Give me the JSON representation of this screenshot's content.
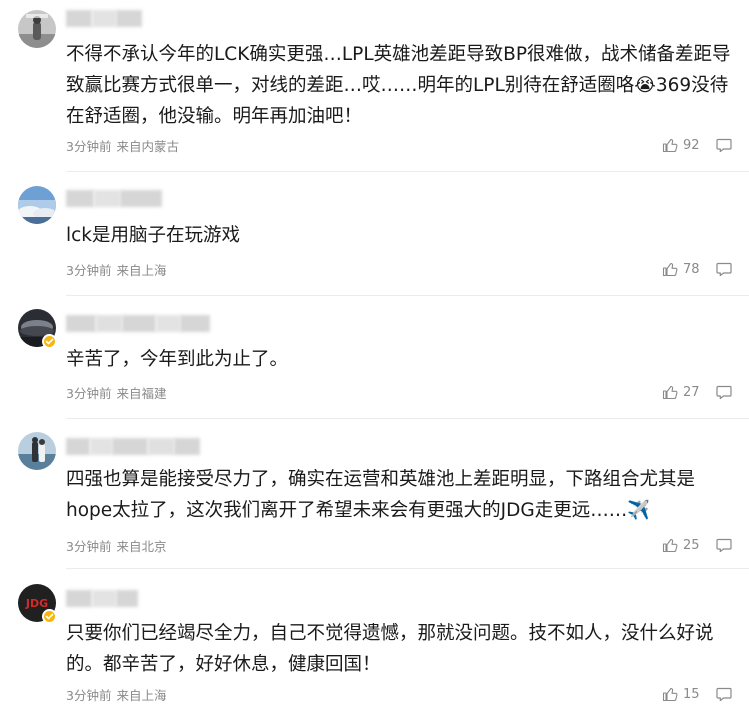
{
  "comments": [
    {
      "text": "不得不承认今年的LCK确实更强…LPL英雄池差距导致BP很难做，战术储备差距导致赢比赛方式很单一，对线的差距…哎……明年的LPL别待在舒适圈咯😭369没待在舒适圈，他没输。明年再加油吧！",
      "time": "3分钟前",
      "location": "来自内蒙古",
      "likes": "92",
      "verified": false
    },
    {
      "text": "lck是用脑子在玩游戏",
      "time": "3分钟前",
      "location": "来自上海",
      "likes": "78",
      "verified": false
    },
    {
      "text": "辛苦了，今年到此为止了。",
      "time": "3分钟前",
      "location": "来自福建",
      "likes": "27",
      "verified": true
    },
    {
      "text": "四强也算是能接受尽力了，确实在运营和英雄池上差距明显，下路组合尤其是hope太拉了，这次我们离开了希望未来会有更强大的JDG走更远……✈️",
      "time": "3分钟前",
      "location": "来自北京",
      "likes": "25",
      "verified": false
    },
    {
      "text": "只要你们已经竭尽全力，自己不觉得遗憾，那就没问题。技不如人，没什么好说的。都辛苦了，好好休息，健康回国！",
      "time": "3分钟前",
      "location": "来自上海",
      "likes": "15",
      "verified": true
    }
  ],
  "icons": {
    "like": "thumbs-up-icon",
    "reply": "comment-bubble-icon",
    "verified": "verified-badge-icon"
  },
  "colors": {
    "text": "#1a1a1a",
    "meta": "#8a8a8a",
    "badge": "#f6b60b",
    "divider": "#ececec"
  }
}
